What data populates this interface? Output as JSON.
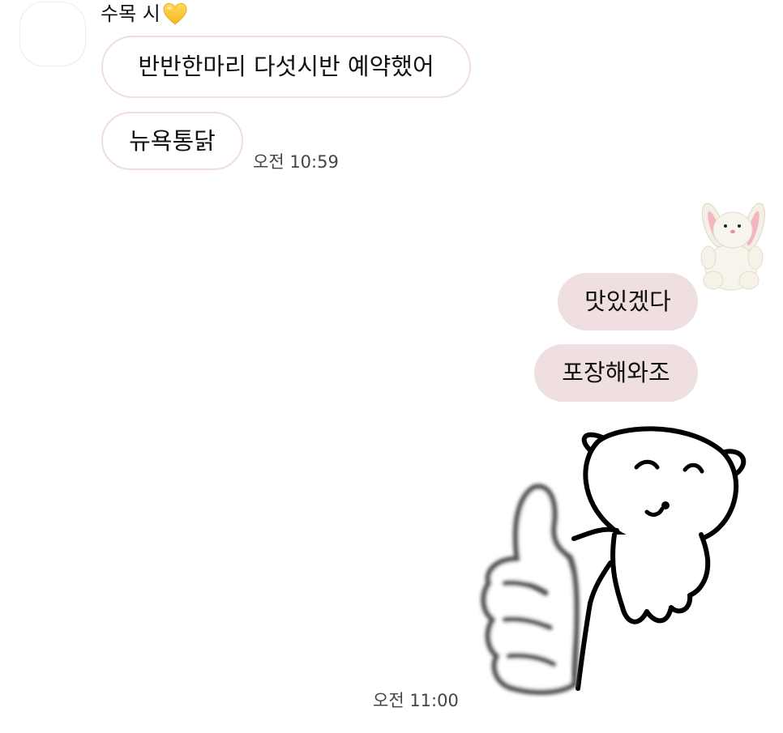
{
  "incoming": {
    "sender_name": "수목 시",
    "name_emoji_icon": "yellow-heart-icon",
    "messages": [
      "반반한마리 다섯시반 예약했어",
      "뉴욕통닭"
    ],
    "time": "오전 10:59"
  },
  "outgoing": {
    "emoticon_icon": "plush-bunny-icon",
    "messages": [
      "맛있겠다",
      "포장해와조"
    ],
    "sticker_icon": "thumbs-up-bear-sticker",
    "time": "오전 11:00"
  },
  "colors": {
    "outgoing_bubble": "#efdfe0",
    "incoming_bubble_border": "#f0dde0",
    "background": "#ffffff",
    "heart": "#f7c93e"
  }
}
